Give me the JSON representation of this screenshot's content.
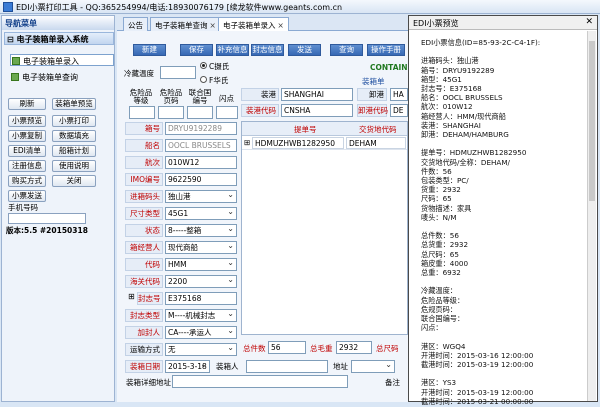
{
  "window_title": "EDI小票打印工具 - QQ:365254994/电话:18930076179 [续龙软件www.geants.com.cn",
  "sidebar": {
    "header": "导航菜单",
    "menu_header": "电子装箱单录入系统",
    "items": [
      {
        "label": "电子装箱单录入",
        "selected": true
      },
      {
        "label": "电子装箱单查询",
        "selected": false
      }
    ],
    "buttons": [
      "刷新",
      "装箱单预览",
      "小票预览",
      "小票打印",
      "小票复制",
      "数据填充",
      "EDI清单",
      "船箱计划",
      "注册信息",
      "使用说明",
      "购买方式",
      "关闭",
      "小票发送"
    ],
    "phone_label": "手机号码",
    "version": "版本:5.5 #20150318"
  },
  "tabs": [
    "公告",
    "电子装箱单查询",
    "电子装箱单录入"
  ],
  "toolbar": [
    "新建",
    "保存",
    "补充信息",
    "封志信息",
    "发送",
    "查询",
    "操作手册"
  ],
  "form": {
    "reefer_temp_label": "冷藏温度",
    "radio_c": "C摄氏",
    "radio_f": "F华氏",
    "container_label": "CONTAINE",
    "hazard_headers": [
      "危险品等级",
      "危险品页码",
      "联合国编号",
      "闪点"
    ],
    "box_no_label": "箱号",
    "box_no": "DRYU9192289",
    "ship_label": "船名",
    "ship": "OOCL BRUSSELS",
    "voyage_label": "航次",
    "voyage": "010W12",
    "imo_label": "IMO编号",
    "imo": "9622590",
    "loading_terminal_label": "进箱码头",
    "loading_terminal": "独山港",
    "size_label": "尺寸类型",
    "size": "45G1",
    "status_label": "状态",
    "status": "8-----整箱",
    "operator_label": "箱经营人",
    "operator": "现代商船",
    "code_label": "代码",
    "code": "HMM",
    "customs_label": "海关代码",
    "customs": "2200",
    "seal_label": "封志号",
    "seal": "E375168",
    "sealer_type_label": "封志类型",
    "sealer_type": "M----机械封志",
    "sealer_label": "加封人",
    "sealer": "CA----承运人",
    "transport_label": "运输方式",
    "transport": "无",
    "box_date_label": "装箱日期",
    "box_date": "2015-3-18",
    "packer_label": "装箱人",
    "address_label": "地址",
    "detail_addr_label": "装箱详细地址",
    "remark_label": "备注",
    "loading_port_label": "装港",
    "loading_port": "SHANGHAI",
    "loading_port_code_label": "装港代码",
    "loading_port_code": "CNSHA",
    "discharge_label": "卸港",
    "discharge_value": "HA",
    "discharge_code_label": "卸港代码",
    "discharge_code": "DE",
    "box_label": "装箱单",
    "total_pieces_label": "总件数",
    "total_pieces": "56",
    "total_weight_label": "总毛重",
    "total_weight": "2932",
    "total_volume_label": "总尺码",
    "grid_headers": [
      "提单号",
      "交货地代码"
    ],
    "grid_rows": [
      [
        "HDMUZHWB1282950",
        "DEHAM"
      ]
    ]
  },
  "preview": {
    "title": "EDI小票预览",
    "lines": [
      "EDI小票信息(ID=85-93-2C-C4-1F):",
      "",
      "进箱码头：独山港",
      "箱号：DRYU9192289",
      "箱型：45G1",
      "封志号：E375168",
      "船名：OOCL BRUSSELS",
      "航次：010W12",
      "箱经营人：HMM/现代商船",
      "装港：SHANGHAI",
      "卸港：DEHAM/HAMBURG",
      "",
      "提单号：HDMUZHWB1282950",
      "交货地代码/全称：DEHAM/",
      "件数：56",
      "包装类型：PC/",
      "货重：2932",
      "尺码：65",
      "货物描述：家具",
      "唛头：N/M",
      "",
      "总件数：56",
      "总货重：2932",
      "总尺码：65",
      "箱皮重：4000",
      "总重：6932",
      "",
      "冷藏温度：",
      "危险品等级：",
      "危规页码：",
      "联合国编号：",
      "闪点：",
      "",
      "港区：WGQ4",
      "开港时间：2015-03-16 12:00:00",
      "截港时间：2015-03-19 12:00:00",
      "",
      "港区：YS3",
      "开港时间：2015-03-19 12:00:00",
      "截港时间：2015-03-21 00:00:00"
    ]
  }
}
